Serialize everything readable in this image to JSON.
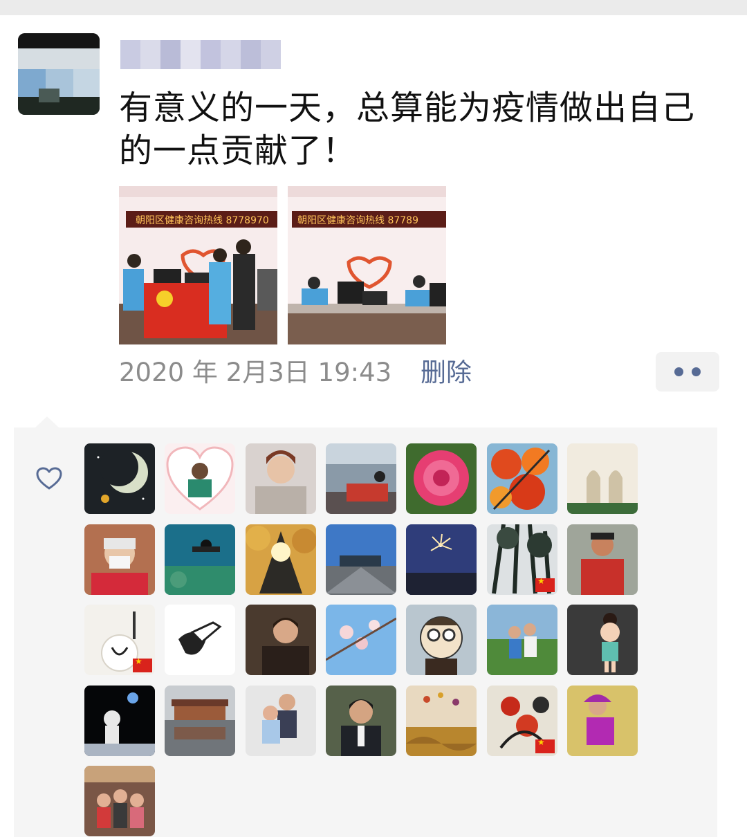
{
  "post": {
    "text": "有意义的一天，总算能为疫情做出自己的一点贡献了！",
    "photos": [
      {
        "banner": "朝阳区健康咨询热线  8778970"
      },
      {
        "banner": "朝阳区健康咨询热线  87789"
      }
    ],
    "timestamp": "2020 年 2月3日  19:43",
    "delete_label": "删除",
    "more_icon": "more-dots-icon"
  },
  "likes": {
    "heart_icon": "heart-outline-icon",
    "avatars": [
      {
        "name": "moon-avatar",
        "theme": "moon"
      },
      {
        "name": "heart-frame-avatar",
        "theme": "heart"
      },
      {
        "name": "woman-fur-avatar",
        "theme": "fur"
      },
      {
        "name": "seaside-avatar",
        "theme": "sea"
      },
      {
        "name": "pink-flower-avatar",
        "theme": "flower"
      },
      {
        "name": "red-leaves-avatar",
        "theme": "leaves"
      },
      {
        "name": "mosque-avatar",
        "theme": "mosque"
      },
      {
        "name": "masked-man-avatar",
        "theme": "mask"
      },
      {
        "name": "diver-avatar",
        "theme": "diver"
      },
      {
        "name": "autumn-trees-avatar",
        "theme": "autumn"
      },
      {
        "name": "street-avatar",
        "theme": "street"
      },
      {
        "name": "sparkler-avatar",
        "theme": "sparkler"
      },
      {
        "name": "forest-flag-avatar",
        "theme": "forest",
        "flag": true
      },
      {
        "name": "hiker-avatar",
        "theme": "hiker"
      },
      {
        "name": "calligraphy-flag-avatar",
        "theme": "calligraphy",
        "flag": true
      },
      {
        "name": "cartoon-hero-avatar",
        "theme": "hero"
      },
      {
        "name": "man-portrait-avatar",
        "theme": "portrait"
      },
      {
        "name": "cherry-blossom-avatar",
        "theme": "blossom"
      },
      {
        "name": "cartoon-kid-avatar",
        "theme": "cartoon"
      },
      {
        "name": "kids-park-avatar",
        "theme": "kids"
      },
      {
        "name": "girl-cartoon-avatar",
        "theme": "girl"
      },
      {
        "name": "astronaut-avatar",
        "theme": "astronaut"
      },
      {
        "name": "pavilion-avatar",
        "theme": "pavilion"
      },
      {
        "name": "couple-avatar",
        "theme": "couple"
      },
      {
        "name": "suit-man-avatar",
        "theme": "suit"
      },
      {
        "name": "balloons-avatar",
        "theme": "balloons"
      },
      {
        "name": "ink-flower-flag-avatar",
        "theme": "ink",
        "flag": true
      },
      {
        "name": "woman-purple-avatar",
        "theme": "purple"
      },
      {
        "name": "family-avatar",
        "theme": "family"
      }
    ]
  },
  "colors": {
    "link": "#576b95",
    "meta": "#8c8c8c",
    "panel": "#f5f5f5"
  }
}
